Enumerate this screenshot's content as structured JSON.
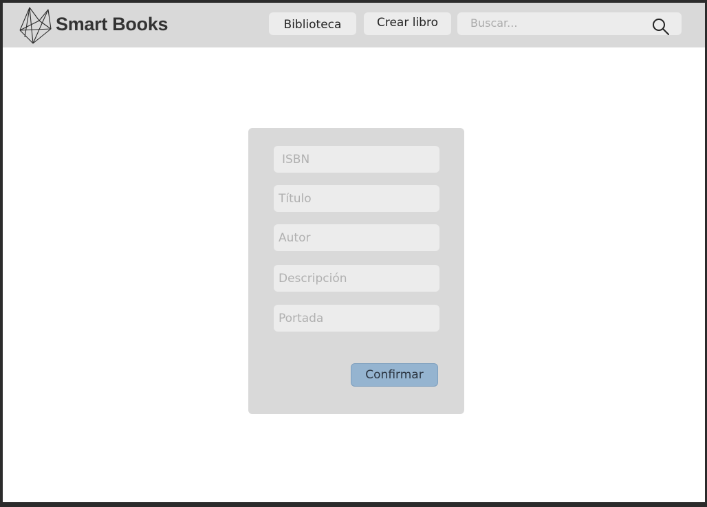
{
  "header": {
    "brand": "Smart Books",
    "logo_icon": "geometric-crystal-logo-icon",
    "nav": {
      "library_label": "Biblioteca",
      "create_label": "Crear libro"
    },
    "search": {
      "placeholder": "Buscar...",
      "value": "",
      "icon": "search-icon"
    }
  },
  "form": {
    "fields": [
      {
        "placeholder": "ISBN",
        "value": ""
      },
      {
        "placeholder": "Título",
        "value": ""
      },
      {
        "placeholder": "Autor",
        "value": ""
      },
      {
        "placeholder": "Descripción",
        "value": ""
      },
      {
        "placeholder": "Portada",
        "value": ""
      }
    ],
    "confirm_label": "Confirmar"
  },
  "colors": {
    "header_bg": "#d9d9d9",
    "panel_bg": "#d9d9d9",
    "field_bg": "#ececec",
    "accent": "#95b4d0",
    "frame_border": "#2b2b2b"
  }
}
